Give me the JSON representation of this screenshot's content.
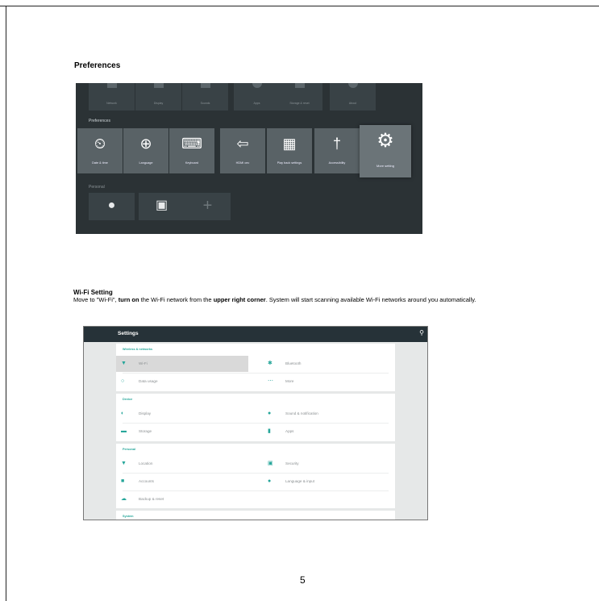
{
  "section1_heading": "Preferences",
  "tv": {
    "top_row": [
      "Network",
      "Display",
      "Sounds",
      "Apps",
      "Storage & reset",
      "About"
    ],
    "preferences_label": "Preferences",
    "tiles": [
      {
        "label": "Date & time",
        "icon": "clock-icon",
        "glyph": "⏲"
      },
      {
        "label": "Language",
        "icon": "globe-icon",
        "glyph": "⊕"
      },
      {
        "label": "Keyboard",
        "icon": "keyboard-icon",
        "glyph": "⌨"
      },
      {
        "label": "HDMI cec",
        "icon": "input-icon",
        "glyph": "⇦"
      },
      {
        "label": "Play back settings",
        "icon": "film-icon",
        "glyph": "▦"
      },
      {
        "label": "Accessibility",
        "icon": "accessibility-icon",
        "glyph": "†"
      },
      {
        "label": "More setting",
        "icon": "gear-icon",
        "glyph": "⚙"
      }
    ],
    "personal_label": "Personal"
  },
  "section2_heading": "Wi-Fi Setting",
  "section2_body": {
    "t1": "Move to \"Wi-Fi\", ",
    "b1": "turn on",
    "t2": " the Wi-Fi network from the ",
    "b2": "upper right corner",
    "t3": ". System will start scanning available Wi-Fi networks around you automatically."
  },
  "settings": {
    "title": "Settings",
    "wireless_header": "Wireless & networks",
    "wifi": "Wi-Fi",
    "bluetooth": "Bluetooth",
    "data_usage": "Data usage",
    "more": "More",
    "device_header": "Device",
    "display": "Display",
    "sound": "Sound & notification",
    "storage": "Storage",
    "apps": "Apps",
    "personal_header": "Personal",
    "location": "Location",
    "security": "Security",
    "accounts": "Accounts",
    "language": "Language & input",
    "backup": "Backup & reset",
    "system_header": "System"
  },
  "colors": {
    "accent": "#26a69a",
    "toolbar": "#263238",
    "tv_bg": "#2b3235"
  },
  "page_number": "5"
}
